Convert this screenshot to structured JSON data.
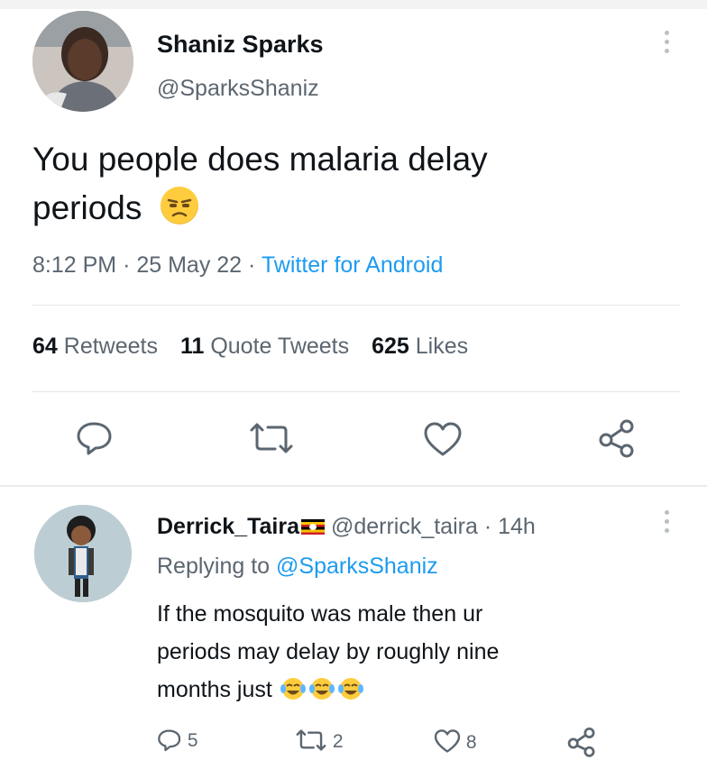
{
  "tweet": {
    "display_name": "Shaniz Sparks",
    "handle": "@SparksShaniz",
    "text_line1": "You people does malaria delay",
    "text_line2": "periods",
    "emoji_icon": "unamused-face-emoji",
    "time": "8:12 PM",
    "date": "25 May 22",
    "source": "Twitter for Android",
    "stats": {
      "retweets_count": "64",
      "retweets_label": "Retweets",
      "quotes_count": "11",
      "quotes_label": "Quote Tweets",
      "likes_count": "625",
      "likes_label": "Likes"
    },
    "actions": [
      "reply-icon",
      "retweet-icon",
      "like-icon",
      "share-icon"
    ]
  },
  "reply": {
    "display_name": "Derrick_Taira",
    "flag_icon": "uganda-flag",
    "handle": "@derrick_taira",
    "time_ago": "14h",
    "replying_label": "Replying to",
    "replying_to": "@SparksShaniz",
    "text_line1": "If the mosquito was male then ur",
    "text_line2": "periods may delay by roughly nine",
    "text_line3": "months just",
    "emoji_icon": "face-with-tears-of-joy-emoji",
    "reply_count": "5",
    "retweet_count": "2",
    "like_count": "8"
  },
  "colors": {
    "text": "#0f1419",
    "muted": "#5b6670",
    "accent": "#1d9bf0",
    "divider": "#e3e6e8"
  }
}
